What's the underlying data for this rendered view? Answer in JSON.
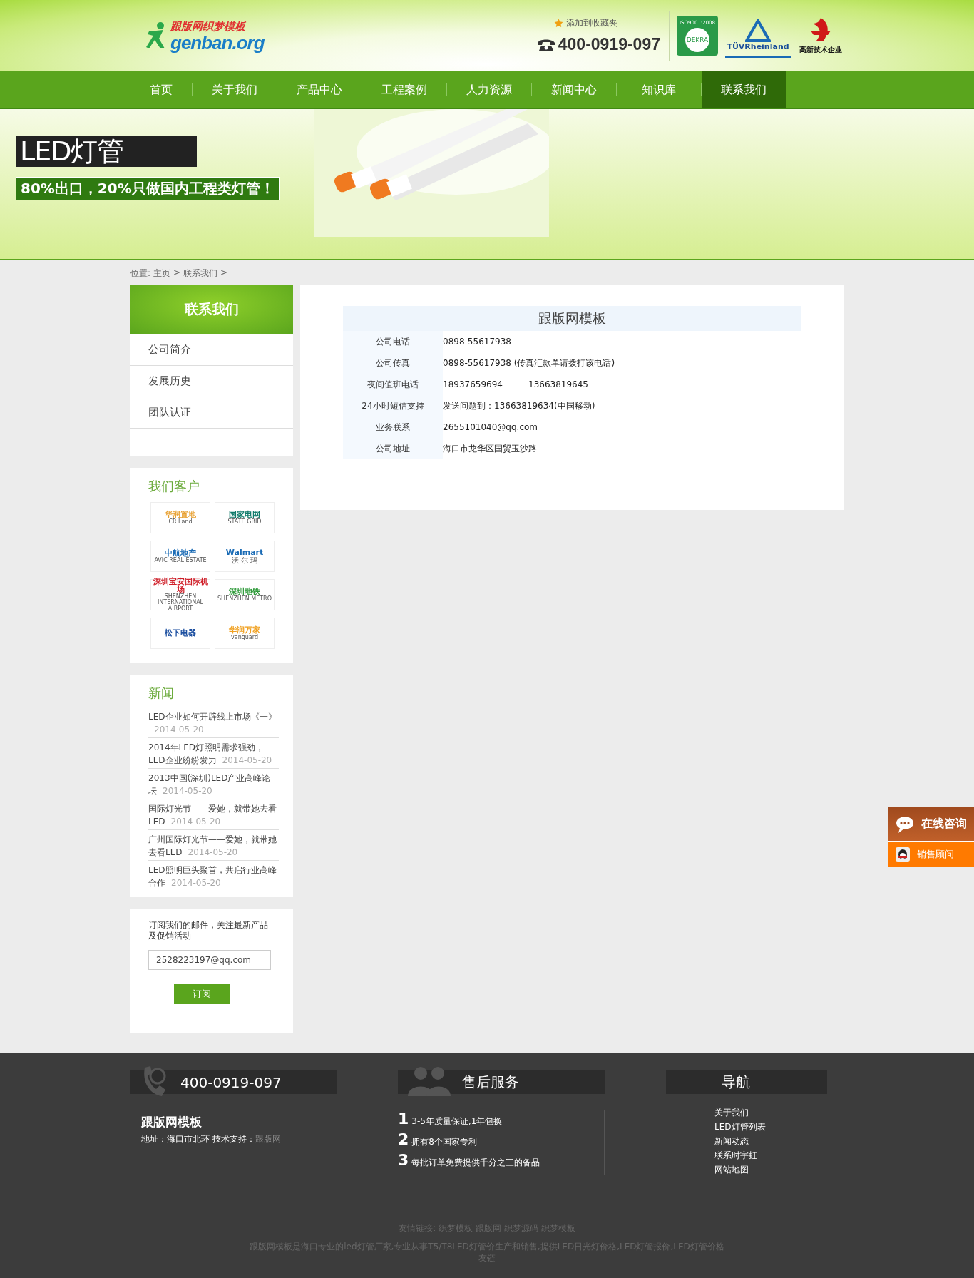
{
  "header": {
    "logo_title": "跟版网织梦模板",
    "logo_domain": "genban.org",
    "favorite": "添加到收藏夹",
    "phone": "400-0919-097",
    "certs": [
      {
        "kind": "dekra",
        "top": "ISO9001:2008",
        "label": "DEKRA"
      },
      {
        "kind": "tuv",
        "label": "TÜVRheinland"
      },
      {
        "kind": "hightech",
        "label": "高新技术企业"
      }
    ]
  },
  "nav": [
    {
      "label": "首页",
      "selected": false
    },
    {
      "label": "关于我们",
      "selected": false
    },
    {
      "label": "产品中心",
      "selected": false
    },
    {
      "label": "工程案例",
      "selected": false
    },
    {
      "label": "人力资源",
      "selected": false
    },
    {
      "label": "新闻中心",
      "selected": false
    },
    {
      "label": "知识库",
      "selected": false
    },
    {
      "label": "联系我们",
      "selected": true
    }
  ],
  "banner": {
    "title": "LED灯管",
    "subtitle": "80%出口，20%只做国内工程类灯管！"
  },
  "breadcrumb": {
    "prefix": "位置:",
    "items": [
      "主页",
      "联系我们"
    ],
    "separator": ">"
  },
  "sidebar": {
    "title": "联系我们",
    "items": [
      "公司简介",
      "发展历史",
      "团队认证"
    ]
  },
  "clients": {
    "title": "我们客户",
    "logos": [
      {
        "name": "华润置地",
        "sub": "CR Land",
        "color": "#e8a030"
      },
      {
        "name": "国家电网",
        "sub": "STATE GRID",
        "color": "#0f7a6a"
      },
      {
        "name": "中航地产",
        "sub": "AVIC REAL ESTATE",
        "color": "#1a6bb5"
      },
      {
        "name": "Walmart",
        "sub": "沃 尔 玛",
        "color": "#1a6bb5"
      },
      {
        "name": "深圳宝安国际机场",
        "sub": "SHENZHEN INTERNATIONAL AIRPORT",
        "color": "#d0202a"
      },
      {
        "name": "深圳地铁",
        "sub": "SHENZHEN METRO",
        "color": "#2f9a3a"
      },
      {
        "name": "松下电器",
        "color": "#1c4fa0"
      },
      {
        "name": "华润万家",
        "sub": "vanguard",
        "color": "#f0a020"
      }
    ]
  },
  "news": {
    "title": "新闻",
    "items": [
      {
        "title": "LED企业如何开辟线上市场《一》",
        "date": "2014-05-20"
      },
      {
        "title": "2014年LED灯照明需求强劲，LED企业纷纷发力",
        "date": "2014-05-20"
      },
      {
        "title": "2013中国(深圳)LED产业高峰论坛",
        "date": "2014-05-20"
      },
      {
        "title": "国际灯光节——爱她，就带她去看LED",
        "date": "2014-05-20"
      },
      {
        "title": "广州国际灯光节——爱她，就带她去看LED",
        "date": "2014-05-20"
      },
      {
        "title": "LED照明巨头聚首，共启行业高峰合作",
        "date": "2014-05-20"
      }
    ]
  },
  "subscribe": {
    "text": "订阅我们的邮件，关注最新产品及促销活动",
    "email": "2528223197@qq.com",
    "button": "订阅"
  },
  "contact": {
    "title": "跟版网模板",
    "rows": [
      {
        "label": "公司电话",
        "values": [
          "0898-55617938"
        ]
      },
      {
        "label": "公司传真",
        "values": [
          "0898-55617938 (传真汇款单请拨打该电话)"
        ]
      },
      {
        "label": "夜间值班电话",
        "values": [
          "18937659694",
          "13663819645"
        ]
      },
      {
        "label": "24小时短信支持",
        "values": [
          "发送问题到：13663819634(中国移动)"
        ]
      },
      {
        "label": "业务联系",
        "values": [
          "2655101040@qq.com"
        ]
      },
      {
        "label": "公司地址",
        "values": [
          "海口市龙华区国贸玉沙路"
        ]
      }
    ]
  },
  "float_widget": {
    "title": "在线咨询",
    "item": "销售顾问"
  },
  "footer": {
    "phone": "400-0919-097",
    "company": "跟版网模板",
    "address": "地址：海口市北环 技术支持：",
    "support_link": "跟版网",
    "service_title": "售后服务",
    "points": [
      {
        "num": "1",
        "text": "3-5年质量保证,1年包换"
      },
      {
        "num": "2",
        "text": "拥有8个国家专利"
      },
      {
        "num": "3",
        "text": "每批订单免费提供千分之三的备品"
      }
    ],
    "nav_title": "导航",
    "nav_links": [
      "关于我们",
      "LED灯管列表",
      "新闻动态",
      "联系时宇虹",
      "网站地图"
    ],
    "friend_label": "友情链接:",
    "friend_links": [
      "织梦模板",
      "跟版网",
      "织梦源码",
      "织梦模板"
    ],
    "description": "跟版网模板是海口专业的led灯管厂家,专业从事T5/T8LED灯管价生产和销售,提供LED日光灯价格,LED灯管报价,LED灯管价格",
    "description_tail": "友链"
  }
}
